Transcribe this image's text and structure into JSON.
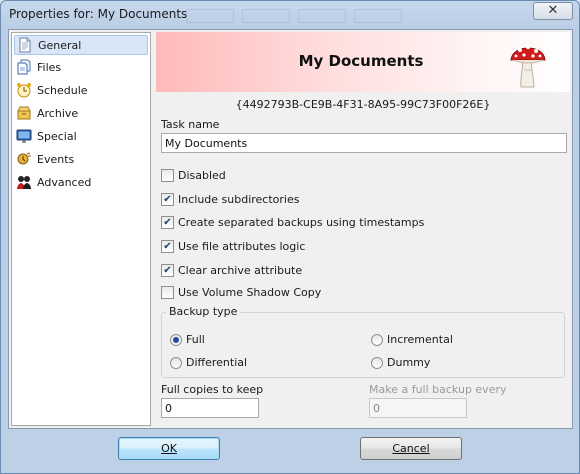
{
  "window": {
    "title": "Properties for: My Documents",
    "close_glyph": "✕"
  },
  "sidebar": {
    "items": [
      {
        "label": "General",
        "icon": "document-icon",
        "selected": true
      },
      {
        "label": "Files",
        "icon": "files-icon"
      },
      {
        "label": "Schedule",
        "icon": "alarm-clock-icon"
      },
      {
        "label": "Archive",
        "icon": "archive-icon"
      },
      {
        "label": "Special",
        "icon": "monitor-icon"
      },
      {
        "label": "Events",
        "icon": "events-icon"
      },
      {
        "label": "Advanced",
        "icon": "advanced-icon"
      }
    ]
  },
  "banner": {
    "title": "My Documents",
    "icon": "mushroom-icon"
  },
  "task": {
    "guid": "{4492793B-CE9B-4F31-8A95-99C73F00F26E}",
    "name_label": "Task name",
    "name_value": "My Documents"
  },
  "options": [
    {
      "label": "Disabled",
      "checked": false
    },
    {
      "label": "Include subdirectories",
      "checked": true
    },
    {
      "label": "Create separated backups using timestamps",
      "checked": true
    },
    {
      "label": "Use file attributes logic",
      "checked": true
    },
    {
      "label": "Clear archive attribute",
      "checked": true
    },
    {
      "label": "Use Volume Shadow Copy",
      "checked": false
    }
  ],
  "backup_type": {
    "label": "Backup type",
    "options": [
      {
        "label": "Full",
        "selected": true
      },
      {
        "label": "Incremental",
        "selected": false
      },
      {
        "label": "Differential",
        "selected": false
      },
      {
        "label": "Dummy",
        "selected": false
      }
    ]
  },
  "copies": {
    "label": "Full copies to keep",
    "value": "0"
  },
  "full_every": {
    "label": "Make a full backup every",
    "value": "0",
    "disabled": true
  },
  "buttons": {
    "ok": "OK",
    "cancel": "Cancel"
  },
  "colors": {
    "selection": "#d8e6f8",
    "banner_start": "#ffb9b9",
    "check": "#1f3f7a"
  }
}
